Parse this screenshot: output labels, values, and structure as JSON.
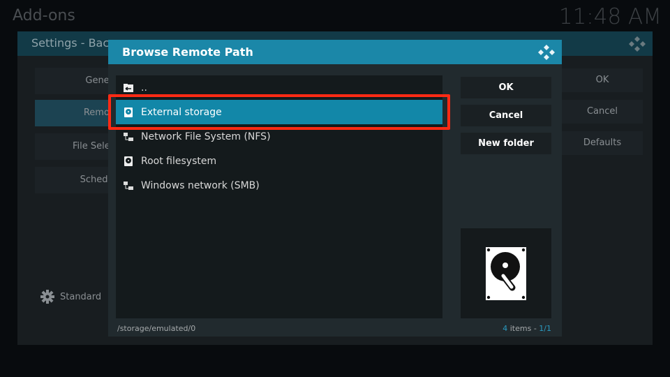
{
  "background_window": {
    "title": "Add-ons",
    "clock": "11:48 AM"
  },
  "settings": {
    "title": "Settings - Bac",
    "menu": [
      {
        "label": "Genera"
      },
      {
        "label": "Remote"
      },
      {
        "label": "File Select"
      },
      {
        "label": "Scheduli"
      }
    ],
    "selected_menu": "Remote",
    "buttons": [
      {
        "label": "OK"
      },
      {
        "label": "Cancel"
      },
      {
        "label": "Defaults"
      }
    ],
    "level": "Standard"
  },
  "dialog": {
    "title": "Browse Remote Path",
    "items": [
      {
        "label": "..",
        "icon": "folder-back-icon"
      },
      {
        "label": "External storage",
        "icon": "hard-drive-icon",
        "selected": true
      },
      {
        "label": "Network File System (NFS)",
        "icon": "network-icon"
      },
      {
        "label": "Root filesystem",
        "icon": "hard-drive-icon"
      },
      {
        "label": "Windows network (SMB)",
        "icon": "network-icon"
      }
    ],
    "buttons": [
      {
        "label": "OK"
      },
      {
        "label": "Cancel"
      },
      {
        "label": "New folder"
      }
    ],
    "preview_icon": "hard-drive-icon",
    "path": "/storage/emulated/0",
    "count": {
      "num": "4",
      "text": " items - ",
      "page": "1/1"
    }
  },
  "colors": {
    "accent": "#1287a8",
    "highlight_box": "#ff2a14"
  }
}
